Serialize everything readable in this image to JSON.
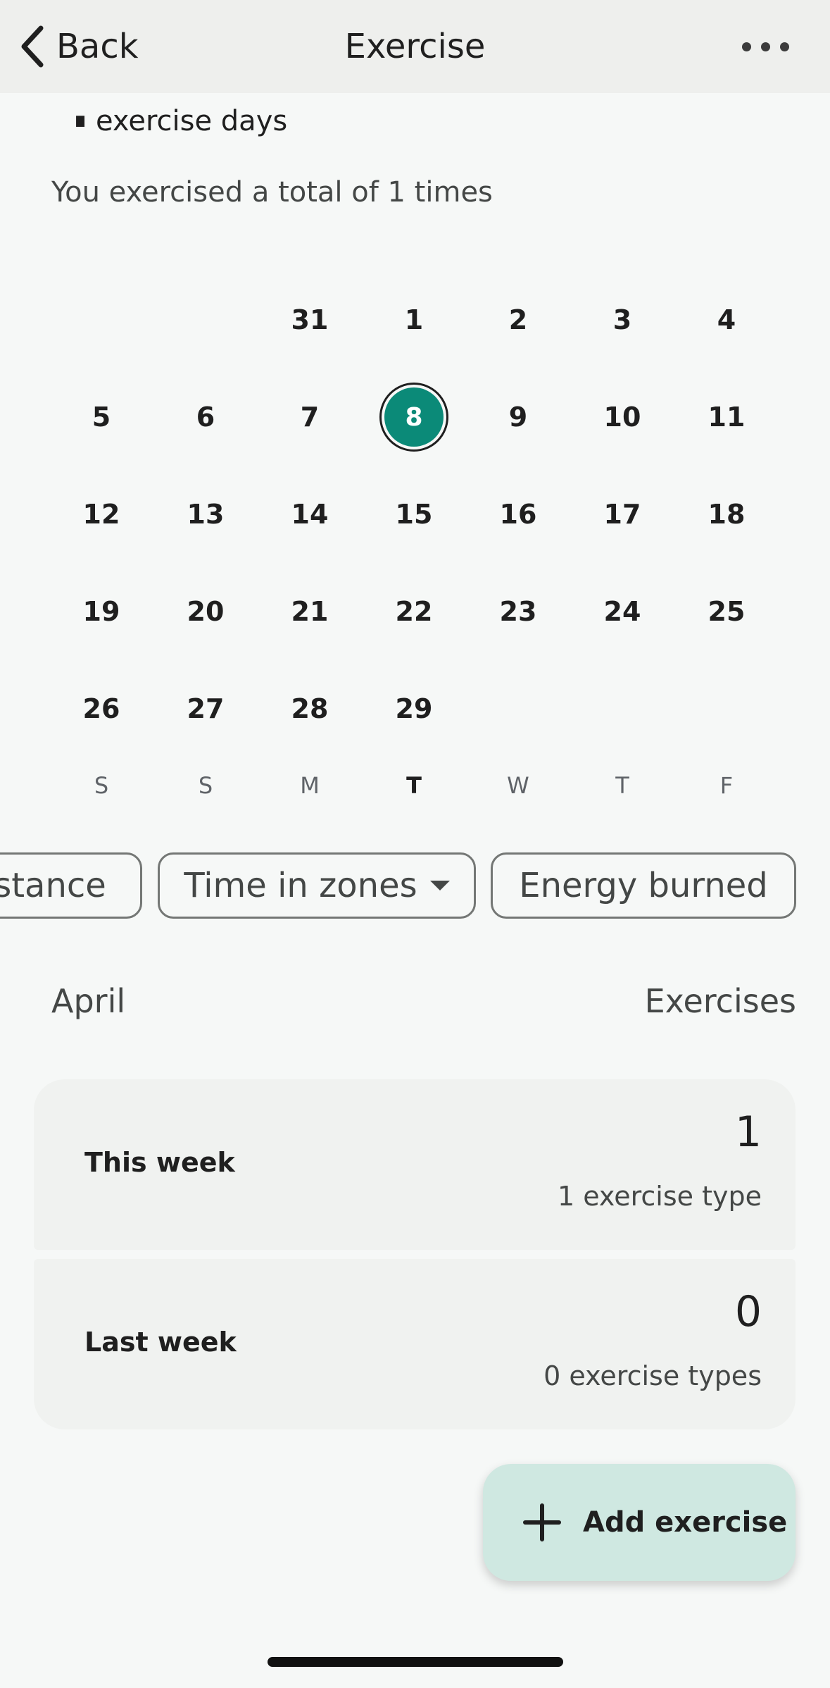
{
  "header": {
    "back_label": "Back",
    "title": "Exercise",
    "more_icon": "more-horizontal-icon"
  },
  "summary": {
    "day_count": "1",
    "day_count_label": "exercise days",
    "total_text": "You exercised a total of 1 times"
  },
  "calendar": {
    "rows": [
      [
        "",
        "",
        "31",
        "1",
        "2",
        "3",
        "4"
      ],
      [
        "5",
        "6",
        "7",
        "8",
        "9",
        "10",
        "11"
      ],
      [
        "12",
        "13",
        "14",
        "15",
        "16",
        "17",
        "18"
      ],
      [
        "19",
        "20",
        "21",
        "22",
        "23",
        "24",
        "25"
      ],
      [
        "26",
        "27",
        "28",
        "29",
        "",
        "",
        ""
      ]
    ],
    "selected_day": "8",
    "weekdays": [
      "S",
      "S",
      "M",
      "T",
      "W",
      "T",
      "F"
    ],
    "today_weekday_index": 3,
    "accent_color": "#0b8a78"
  },
  "filters": {
    "chip_distance": "stance",
    "chip_zones": "Time in zones",
    "chip_energy": "Energy burned"
  },
  "section": {
    "month": "April",
    "column": "Exercises"
  },
  "cards": [
    {
      "label": "This week",
      "value": "1",
      "sub": "1 exercise type"
    },
    {
      "label": "Last week",
      "value": "0",
      "sub": "0 exercise types"
    }
  ],
  "fab": {
    "label": "Add exercise",
    "icon": "plus-icon",
    "color": "#cfe8e1"
  }
}
